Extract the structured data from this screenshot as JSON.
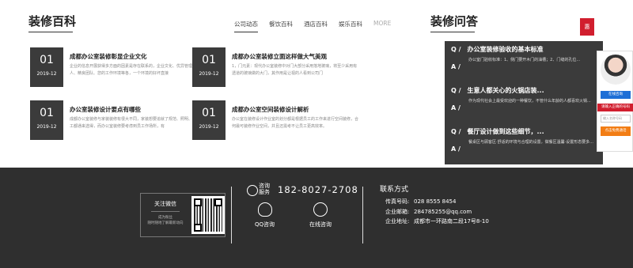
{
  "encyclopedia": {
    "title": "装修百科",
    "tabs": [
      "公司动态",
      "餐饮百科",
      "酒店百科",
      "娱乐百科",
      "MORE"
    ],
    "items": [
      {
        "day": "01",
        "ym": "2019-12",
        "title": "成都办公室装修彰显企业文化",
        "desc": "企业的信息开展获得多方面的因素是存在联系的，企业文化、优异管理人、精良团队、您的工作环境等各，一个环境的好坏直接"
      },
      {
        "day": "01",
        "ym": "2019-12",
        "title": "成都办公室装修立面这样做大气美观",
        "desc": "1，门元素：现代办公室装修中对门大部分采用落地玻璃，将至少采用有透道的玻璃做的大门，其作用是让视的人看到公司门"
      },
      {
        "day": "01",
        "ym": "2019-12",
        "title": "办公室装修设计要点有哪些",
        "desc": "成都办公室装修与家装装修有很大不同，家装想要追就了规范、照明、施工都通来选得，而办公室装修要考虑到员工作场所，有"
      },
      {
        "day": "01",
        "ym": "2019-12",
        "title": "成都办公室空间装修设计解析",
        "desc": "办公室在装修设计作业室的划分都是根据员工的工作来进行空间装修，合何最可装修作业空间，并且还需考不让员工更高效率。"
      }
    ]
  },
  "qa": {
    "title": "装修问答",
    "items": [
      {
        "q": "办公室装修验收的基本标准",
        "a": "办公室门验收标准：1、侧门要开木门的油槽；2、门缝的孔位..."
      },
      {
        "q": "生意人都关心的火锅店装...",
        "a": "作为现代社会上最受欢迎的一种餐饮，不管什么年龄的人都喜欢火锅..."
      },
      {
        "q": "餐厅设计做到这些细节，...",
        "a": "餐桌区与顾客区·舒适的环境与合理的设置，做餐区温馨·设置形态要多..."
      }
    ]
  },
  "side": {
    "red_tab": "惠",
    "online_btn": "在线咨询",
    "phone_btn": "请输入正确的号码",
    "name_placeholder": "输入名称号码",
    "call_btn": "点击免费通话"
  },
  "footer": {
    "wechat_title": "关注微信",
    "wechat_sub1": "成为粉丝",
    "wechat_sub2": "随时随地了解最新动向",
    "phone_label_line1": "咨询",
    "phone_label_line2": "服务",
    "phone_number": "182-8027-2708",
    "qq_label": "QQ咨询",
    "online_label": "在线咨询",
    "contact_title": "联系方式",
    "fax_label": "传真号码:",
    "fax": "028 8555 8454",
    "email_label": "企业邮箱:",
    "email": "284785255@qq.com",
    "address_label": "企业地址:",
    "address": "成都市一环路南二段17号8-10"
  }
}
